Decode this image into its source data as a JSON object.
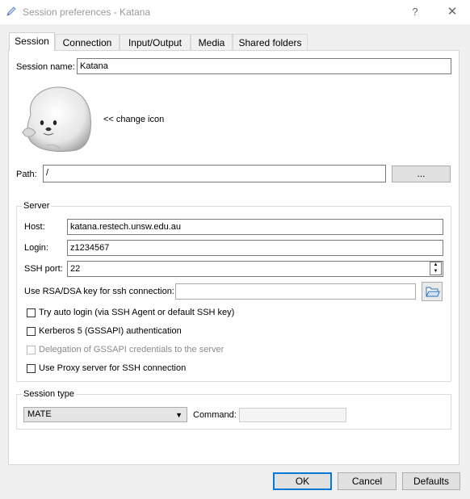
{
  "window": {
    "title": "Session preferences - Katana",
    "help_label": "?",
    "close_label": "✕"
  },
  "tabs": [
    {
      "label": "Session",
      "active": true
    },
    {
      "label": "Connection",
      "active": false
    },
    {
      "label": "Input/Output",
      "active": false
    },
    {
      "label": "Media",
      "active": false
    },
    {
      "label": "Shared folders",
      "active": false
    }
  ],
  "session": {
    "name_label": "Session name:",
    "name_value": "Katana",
    "change_icon_label": "<< change icon",
    "path_label": "Path:",
    "path_value": "/",
    "browse_label": "..."
  },
  "server": {
    "title": "Server",
    "host_label": "Host:",
    "host_value": "katana.restech.unsw.edu.au",
    "login_label": "Login:",
    "login_value": "z1234567",
    "ssh_port_label": "SSH port:",
    "ssh_port_value": "22",
    "rsa_label": "Use RSA/DSA key for ssh connection:",
    "rsa_value": "",
    "auto_login_label": "Try auto login (via SSH Agent or default SSH key)",
    "auto_login_checked": false,
    "kerberos_label": "Kerberos 5 (GSSAPI) authentication",
    "kerberos_checked": false,
    "delegation_label": "Delegation of GSSAPI credentials to the server",
    "delegation_checked": false,
    "delegation_enabled": false,
    "proxy_label": "Use Proxy server for SSH connection",
    "proxy_checked": false
  },
  "session_type": {
    "title": "Session type",
    "selected": "MATE",
    "command_label": "Command:",
    "command_value": ""
  },
  "buttons": {
    "ok": "OK",
    "cancel": "Cancel",
    "defaults": "Defaults"
  },
  "icons": {
    "app": "pen-icon",
    "session": "seal-mascot-icon",
    "folder": "open-folder-icon"
  },
  "colors": {
    "accent": "#0078d7",
    "panel": "#ffffff",
    "window_bg": "#f0f0f0"
  }
}
